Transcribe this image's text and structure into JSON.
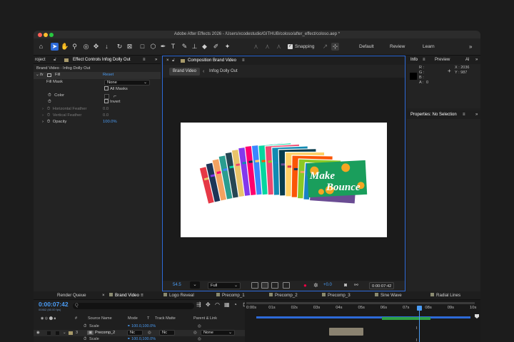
{
  "window": {
    "title": "Adobe After Effects 2026 - /Users/xcodestudio/GITHUB/coloso/after_effect/coloso.aep *"
  },
  "toolbar": {
    "snapping_label": "Snapping",
    "workspaces": [
      "Default",
      "Review",
      "Learn"
    ],
    "more": "»"
  },
  "effect_panel": {
    "tab_left": "roject",
    "tab": "Effect Controls Infog Dolly Out",
    "layer_path": "Brand Video · Infog Dolly Out",
    "effect_name": "Fill",
    "reset": "Reset",
    "rows": {
      "fill_mask": {
        "label": "Fill Mask",
        "value": "None"
      },
      "all_masks": "All Masks",
      "color": "Color",
      "invert": "Invert",
      "h_feather": {
        "label": "Horizontal Feather",
        "value": "0.0"
      },
      "v_feather": {
        "label": "Vertical Feather",
        "value": "0.0"
      },
      "opacity": {
        "label": "Opacity",
        "value": "100.0%"
      }
    }
  },
  "comp_panel": {
    "tab": "Composition Brand Video",
    "breadcrumb_active": "Brand Video",
    "breadcrumb_next": "Infog Dolly Out",
    "artwork_text": [
      "Make",
      "Bounce"
    ],
    "zoom": "54.5",
    "resolution": "Full",
    "exposure": "+0.0",
    "timecode": "0:00:07:42"
  },
  "info_panel": {
    "tabs": [
      "Info",
      "Preview",
      "Al"
    ],
    "labels": {
      "r": "R :",
      "g": "G :",
      "b": "B :",
      "a": "A :"
    },
    "a_value": "0",
    "x": "X : 2036",
    "y": "Y : 987"
  },
  "properties_panel": {
    "tab": "Properties: No Selection"
  },
  "timeline": {
    "tabs": [
      "Render Queue",
      "Brand Video",
      "Logo Reveal",
      "Precomp_1",
      "Precomp_2",
      "Precomp_3",
      "Sine Wave",
      "Radial Lines"
    ],
    "tab_colors": [
      "",
      "#8a8a70",
      "#8a8a70",
      "#8a8a70",
      "#8a8a70",
      "#8a8a70",
      "#8a8a70",
      "#8a8a70"
    ],
    "timecode": "0:00:07:42",
    "timecode_sub": "00462 (60.00 fps)",
    "search_placeholder": "Q",
    "headers": {
      "hash": "#",
      "source": "Source Name",
      "mode": "Mode",
      "t": "T",
      "track_matte": "Track Matte",
      "parent": "Parent & Link"
    },
    "ruler": [
      "0:00s",
      "01s",
      "02s",
      "03s",
      "04s",
      "05s",
      "06s",
      "07s",
      "08s",
      "09s",
      "10s"
    ],
    "rows": [
      {
        "name": "Scale",
        "value": "100.0,100.0%"
      },
      {
        "num": "3",
        "name": "Precomp_2",
        "mode": "Nc",
        "matte": "Nc",
        "parent": "None"
      },
      {
        "name": "Scale",
        "value": "100.0,100.0%"
      }
    ]
  },
  "colors": {
    "accent": "#2d6ad8",
    "timecode": "#4a9cf5",
    "playhead": "#4a9cf5",
    "green_bar": "#2ea043"
  }
}
